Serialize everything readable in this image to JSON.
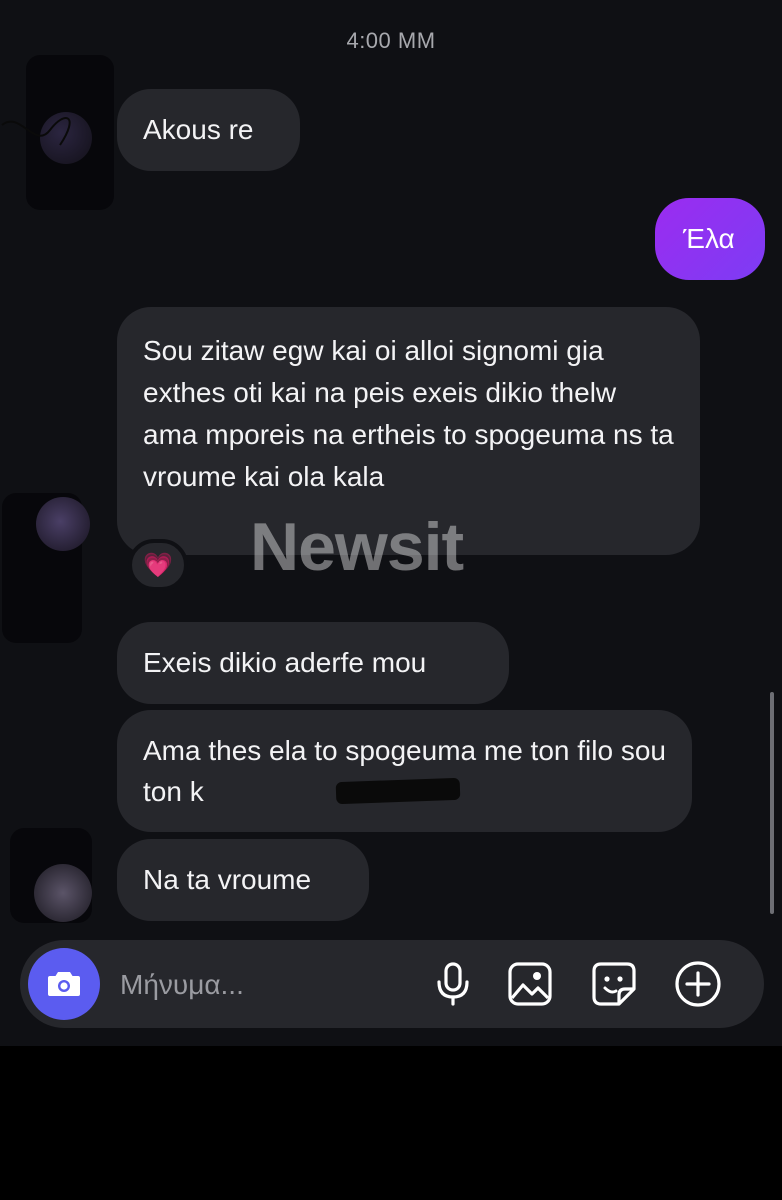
{
  "chat": {
    "timestamp": "4:00 MM",
    "messages": [
      {
        "id": "m1",
        "direction": "incoming",
        "text": "Akous re"
      },
      {
        "id": "m2",
        "direction": "outgoing",
        "text": "Έλα"
      },
      {
        "id": "m3",
        "direction": "incoming",
        "text": "Sou zitaw egw kai oi alloi signomi gia exthes oti kai na peis exeis dikio thelw ama mporeis na ertheis to spogeuma ns ta vroume kai ola kala",
        "reaction": "💗"
      },
      {
        "id": "m4",
        "direction": "incoming",
        "text": "Exeis dikio aderfe mou"
      },
      {
        "id": "m5",
        "direction": "incoming",
        "text": "Ama thes ela to spogeuma me ton filo sou ton k"
      },
      {
        "id": "m6",
        "direction": "incoming",
        "text": "Na ta vroume"
      }
    ]
  },
  "watermark": "Newsit",
  "composer": {
    "placeholder": "Μήνυμα...",
    "icons": [
      "camera-icon",
      "microphone-icon",
      "gallery-icon",
      "sticker-icon",
      "plus-circle-icon"
    ]
  },
  "colors": {
    "background": "#0f1014",
    "incoming_bubble": "#26272c",
    "outgoing_bubble": "#8a2be2",
    "camera_button": "#5b5cf0"
  }
}
